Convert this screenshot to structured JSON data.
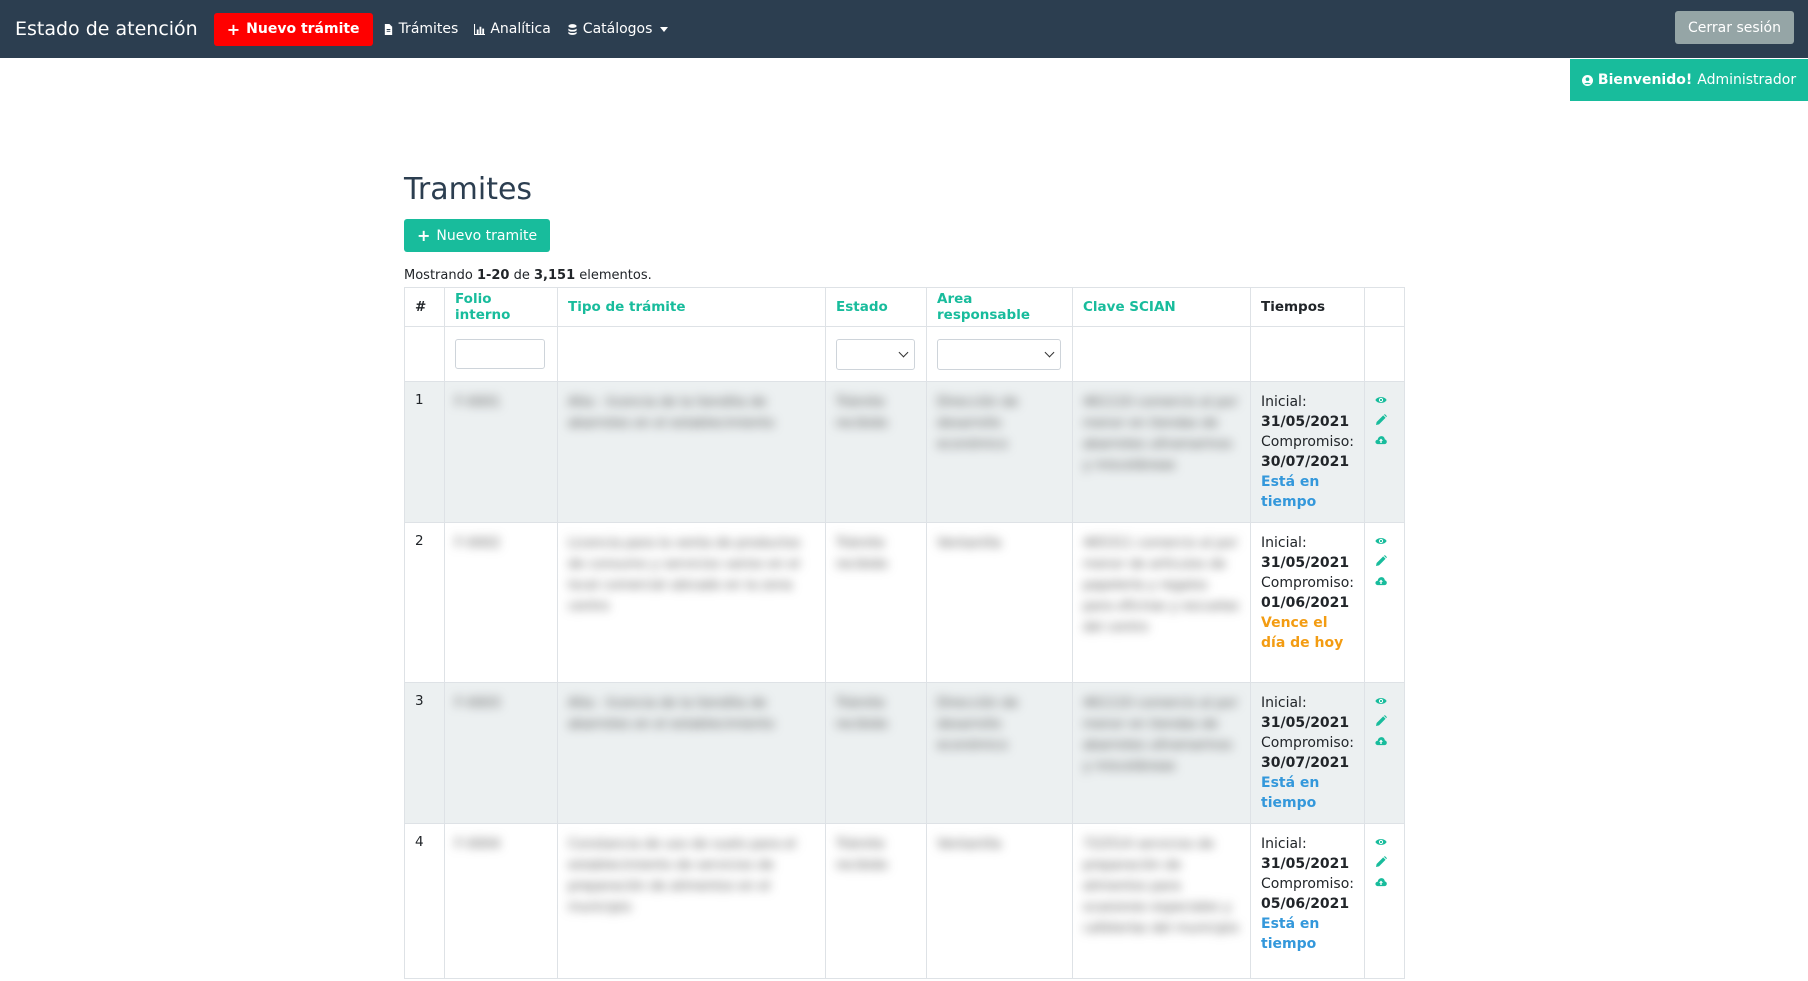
{
  "navbar": {
    "brand": "Estado de atención",
    "cta_label": "Nuevo trámite",
    "links": [
      {
        "label": "Trámites",
        "icon": "file-icon"
      },
      {
        "label": "Analítica",
        "icon": "chart-icon"
      },
      {
        "label": "Catálogos",
        "icon": "database-icon"
      }
    ],
    "logout_label": "Cerrar sesión",
    "colors": {
      "bg": "#2c3e50",
      "cta": "#ff0000"
    }
  },
  "welcome": {
    "greeting": "Bienvenido!",
    "user": "Administrador",
    "color": "#18bc9c"
  },
  "page": {
    "title": "Tramites",
    "new_button": "Nuevo tramite",
    "summary": {
      "prefix": "Mostrando ",
      "range": "1-20",
      "middle": " de ",
      "total": "3,151",
      "suffix": " elementos."
    }
  },
  "table": {
    "headers": [
      "#",
      "Folio interno",
      "Tipo de trámite",
      "Estado",
      "Area responsable",
      "Clave SCIAN",
      "Tiempos"
    ],
    "rows": [
      {
        "num": "1",
        "folio": "F-0001",
        "tipo": "Alta - licencia de la tiendita de abarrotes en el establecimiento",
        "estado": "Trámite recibido",
        "area": "Dirección de desarrollo económico",
        "clave": "461110 comercio al por menor en tiendas de abarrotes ultramarinos y misceláneas",
        "inicial_label": "Inicial:",
        "inicial": "31/05/2021",
        "compromiso_label": "Compromiso:",
        "compromiso": "30/07/2021",
        "status": "Está en tiempo",
        "status_type": "ok"
      },
      {
        "num": "2",
        "folio": "F-0002",
        "tipo": "Licencia para la venta de productos de consumo y servicios varios en el local comercial ubicado en la zona centro",
        "estado": "Trámite recibido",
        "area": "Ventanilla",
        "clave": "465311 comercio al por menor de artículos de papelería y regalos para oficinas y escuelas del centro",
        "inicial_label": "Inicial:",
        "inicial": "31/05/2021",
        "compromiso_label": "Compromiso:",
        "compromiso": "01/06/2021",
        "status": "Vence el día de hoy",
        "status_type": "warn"
      },
      {
        "num": "3",
        "folio": "F-0003",
        "tipo": "Alta - licencia de la tiendita de abarrotes en el establecimiento",
        "estado": "Trámite recibido",
        "area": "Dirección de desarrollo económico",
        "clave": "461110 comercio al por menor en tiendas de abarrotes ultramarinos y misceláneas",
        "inicial_label": "Inicial:",
        "inicial": "31/05/2021",
        "compromiso_label": "Compromiso:",
        "compromiso": "30/07/2021",
        "status": "Está en tiempo",
        "status_type": "ok"
      },
      {
        "num": "4",
        "folio": "F-0004",
        "tipo": "Constancia de uso de suelo para el establecimiento de servicios de preparación de alimentos en el municipio",
        "estado": "Trámite recibido",
        "area": "Ventanilla",
        "clave": "722514 servicios de preparación de alimentos para ocasiones especiales y cafeterías del municipio",
        "inicial_label": "Inicial:",
        "inicial": "31/05/2021",
        "compromiso_label": "Compromiso:",
        "compromiso": "05/06/2021",
        "status": "Está en tiempo",
        "status_type": "ok"
      }
    ]
  },
  "colors": {
    "accent": "#18bc9c",
    "on_time": "#3498db",
    "due_today": "#f39c12"
  }
}
